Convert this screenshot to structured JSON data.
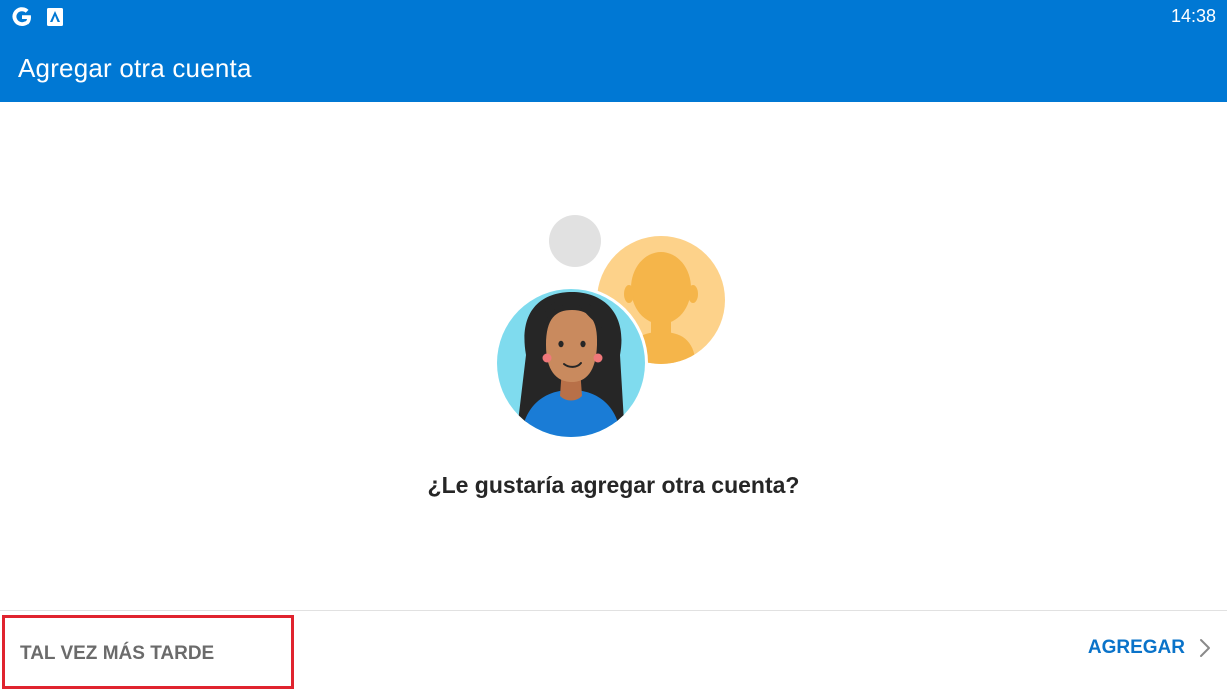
{
  "status_bar": {
    "time": "14:38",
    "icons": [
      "google-g-icon",
      "android-auto-icon"
    ]
  },
  "header": {
    "title": "Agregar otra cuenta"
  },
  "main": {
    "question": "¿Le gustaría agregar otra cuenta?",
    "illustration": "accounts-illustration"
  },
  "footer": {
    "later_label": "TAL VEZ MÁS TARDE",
    "add_label": "AGREGAR"
  },
  "colors": {
    "header_bg": "#0078d4",
    "accent": "#0a73c9",
    "highlight_border": "#e0232e"
  }
}
